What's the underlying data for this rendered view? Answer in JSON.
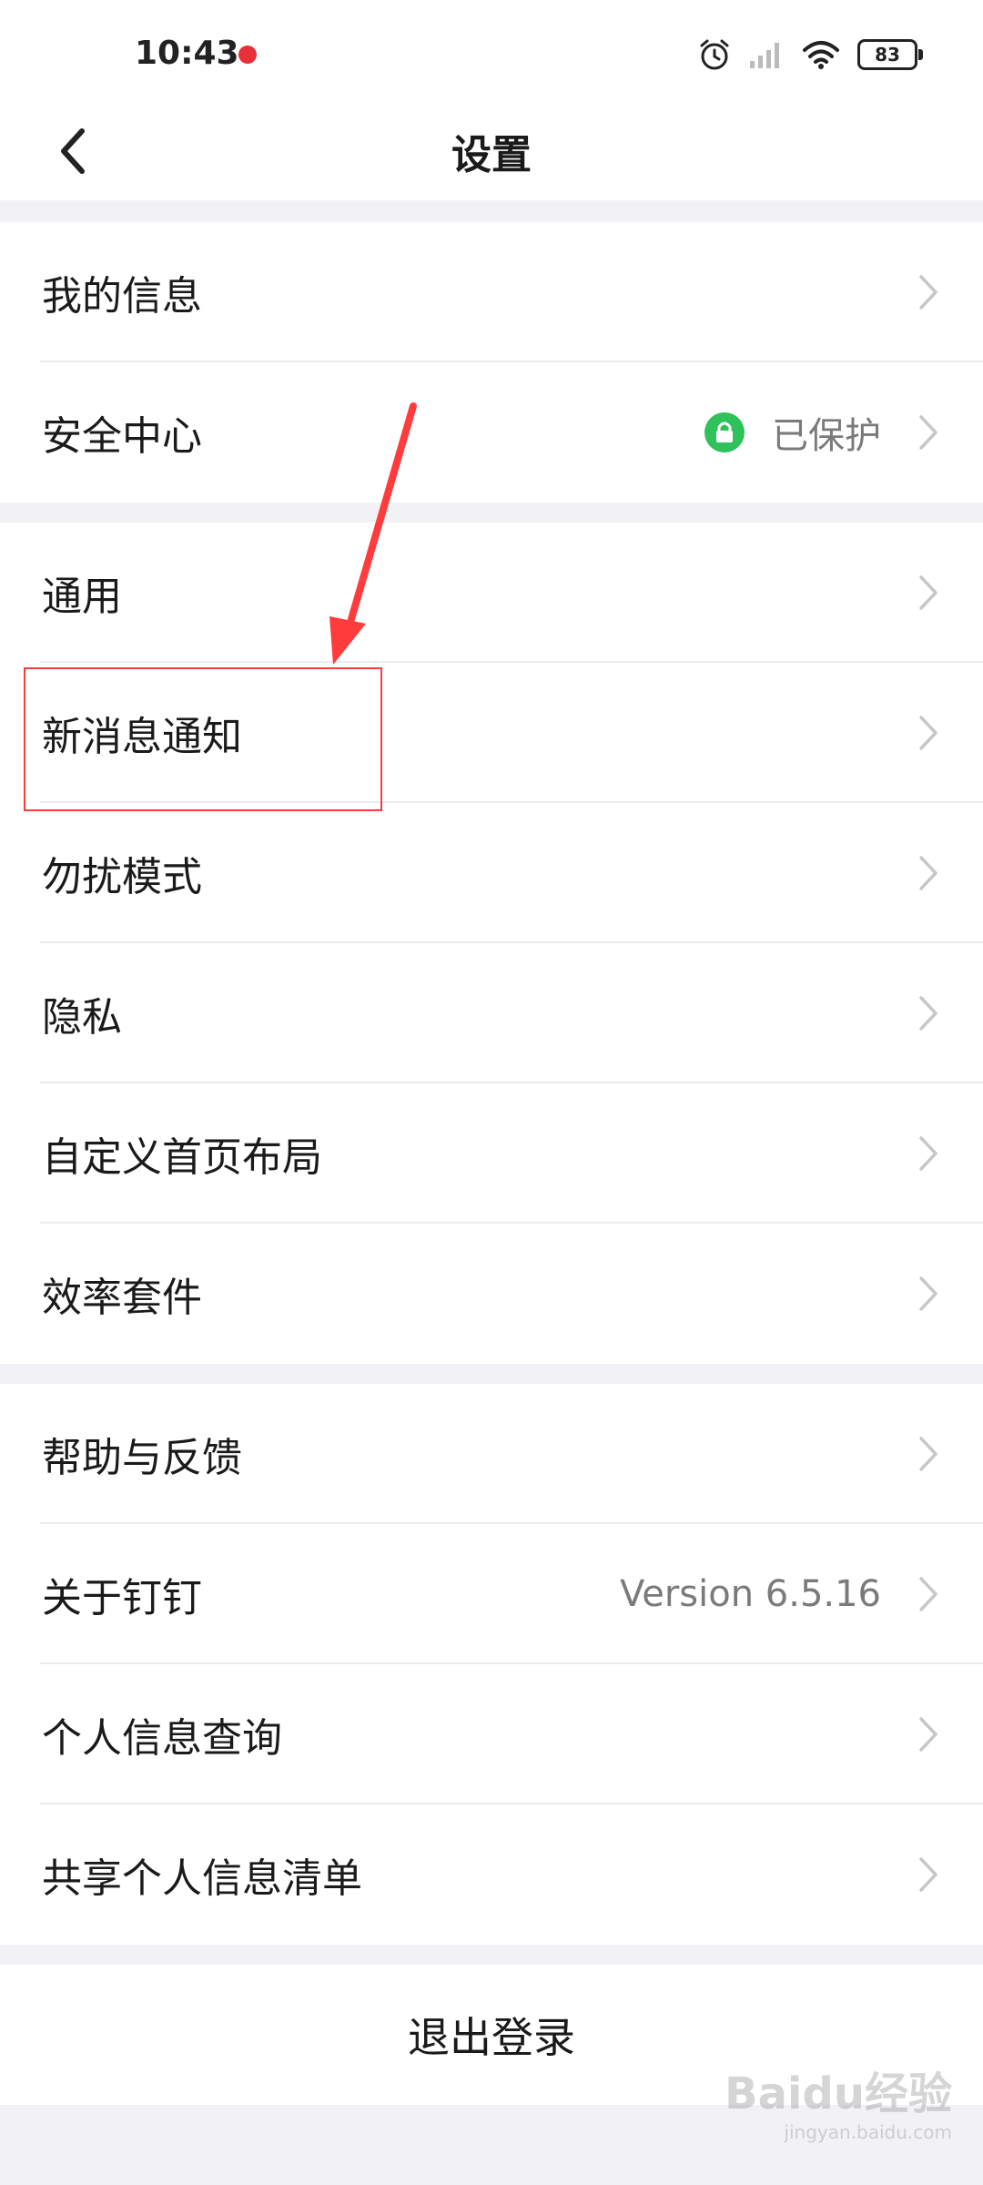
{
  "status_bar": {
    "time": "10:43",
    "battery": "83",
    "icons": [
      "alarm-icon",
      "signal-icon",
      "wifi-icon",
      "battery-icon"
    ]
  },
  "nav": {
    "title": "设置",
    "back_icon": "chevron-left-icon"
  },
  "groups": {
    "account": {
      "my_info": "我的信息",
      "security": "安全中心",
      "security_status": "已保护"
    },
    "main": {
      "general": "通用",
      "notifications": "新消息通知",
      "dnd": "勿扰模式",
      "privacy": "隐私",
      "custom_home": "自定义首页布局",
      "efficiency": "效率套件"
    },
    "about": {
      "help": "帮助与反馈",
      "about": "关于钉钉",
      "version": "Version 6.5.16",
      "personal_query": "个人信息查询",
      "shared_list": "共享个人信息清单"
    }
  },
  "logout": "退出登录",
  "watermark": {
    "main": "Baidu经验",
    "sub": "jingyan.baidu.com"
  },
  "colors": {
    "background": "#f2f2f6",
    "accent_green": "#2fc15a",
    "annotation_red": "#ff3b3b"
  }
}
